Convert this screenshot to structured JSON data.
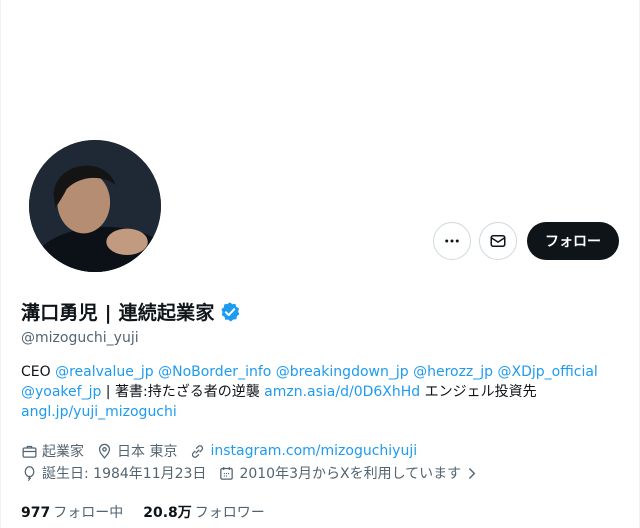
{
  "profile": {
    "name": "溝口勇児 | 連続起業家",
    "handle": "@mizoguchi_yuji",
    "follow_label": "フォロー"
  },
  "bio": {
    "prefix": "CEO ",
    "mention1": "@realvalue_jp",
    "mention2": "@NoBorder_info",
    "mention3": "@breakingdown_jp",
    "mention4": "@herozz_jp",
    "mention5": "@XDjp_official",
    "mention6": "@yoakef_jp",
    "book": " | 著書:持たざる者の逆襲 ",
    "amazon_link": "amzn.asia/d/0D6XhHd",
    "angel": " エンジェル投資先",
    "angel_link": "angl.jp/yuji_mizoguchi"
  },
  "meta": {
    "category": "起業家",
    "location": "日本 東京",
    "website": "instagram.com/mizoguchiyuji",
    "birthday": "誕生日: 1984年11月23日",
    "joined": "2010年3月からXを利用しています"
  },
  "stats": {
    "following_count": "977",
    "following_label": "フォロー中",
    "followers_count": "20.8万",
    "followers_label": "フォロワー"
  },
  "icons": [
    "more-icon",
    "mail-icon",
    "verified-icon",
    "briefcase-icon",
    "location-icon",
    "link-icon",
    "balloon-icon",
    "calendar-icon",
    "chevron-right-icon"
  ],
  "colors": {
    "link": "#1d9bf0",
    "verified": "#1d9bf0",
    "text": "#0f1419",
    "secondary": "#536471",
    "button": "#0f1419"
  }
}
